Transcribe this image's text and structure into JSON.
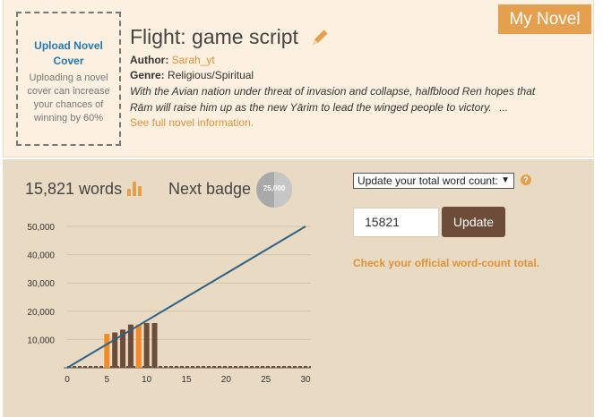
{
  "upload": {
    "title": "Upload Novel Cover",
    "description": "Uploading a novel cover can increase your chances of winning by 60%"
  },
  "novel": {
    "title": "Flight: game script",
    "author_label": "Author:",
    "author": "Sarah_yt",
    "genre_label": "Genre:",
    "genre": "Religious/Spiritual",
    "synopsis": "With the Avian nation under threat of invasion and collapse, halfblood Ren hopes that Rām will raise him up as the new Yārim to lead the winged people to victory.",
    "ellipsis": "...",
    "full_info_link": "See full novel information."
  },
  "tab": {
    "label": "My Novel"
  },
  "stats": {
    "word_count": "15,821 words",
    "next_badge_label": "Next badge",
    "next_badge_value": "25,000"
  },
  "update_form": {
    "select_value": "Update your total word count:",
    "help": "?",
    "input_value": "15821",
    "update_button": "Update",
    "official_link": "Check your official word-count total."
  },
  "colors": {
    "accent_orange": "#e4a04f",
    "link_orange": "#e0913a",
    "bar_brown": "#6d4c39",
    "bar_orange": "#ef8b2c",
    "goal_line": "#2e6285",
    "panel_bg": "#e8dac3",
    "card_bg": "#fcf1e0"
  },
  "icons": {
    "edit": "pencil-icon",
    "words": "bar-chart-icon",
    "badge": "badge-icon",
    "help": "help-icon"
  },
  "chart_data": {
    "type": "bar",
    "x_ticks": [
      "0",
      "5",
      "10",
      "15",
      "20",
      "25",
      "30"
    ],
    "y_ticks": [
      "10,000",
      "20,000",
      "30,000",
      "40,000",
      "50,000"
    ],
    "xlim": [
      0,
      30
    ],
    "ylim": [
      0,
      50000
    ],
    "grid": true,
    "days": [
      5,
      6,
      7,
      8,
      9,
      10,
      11
    ],
    "values": [
      12000,
      12500,
      13500,
      15300,
      15300,
      15821,
      15821
    ],
    "bar_colors": [
      "orange",
      "brown",
      "brown",
      "brown",
      "orange",
      "brown",
      "brown"
    ],
    "goal_line": {
      "x": [
        0,
        30
      ],
      "y": [
        0,
        50000
      ]
    }
  }
}
